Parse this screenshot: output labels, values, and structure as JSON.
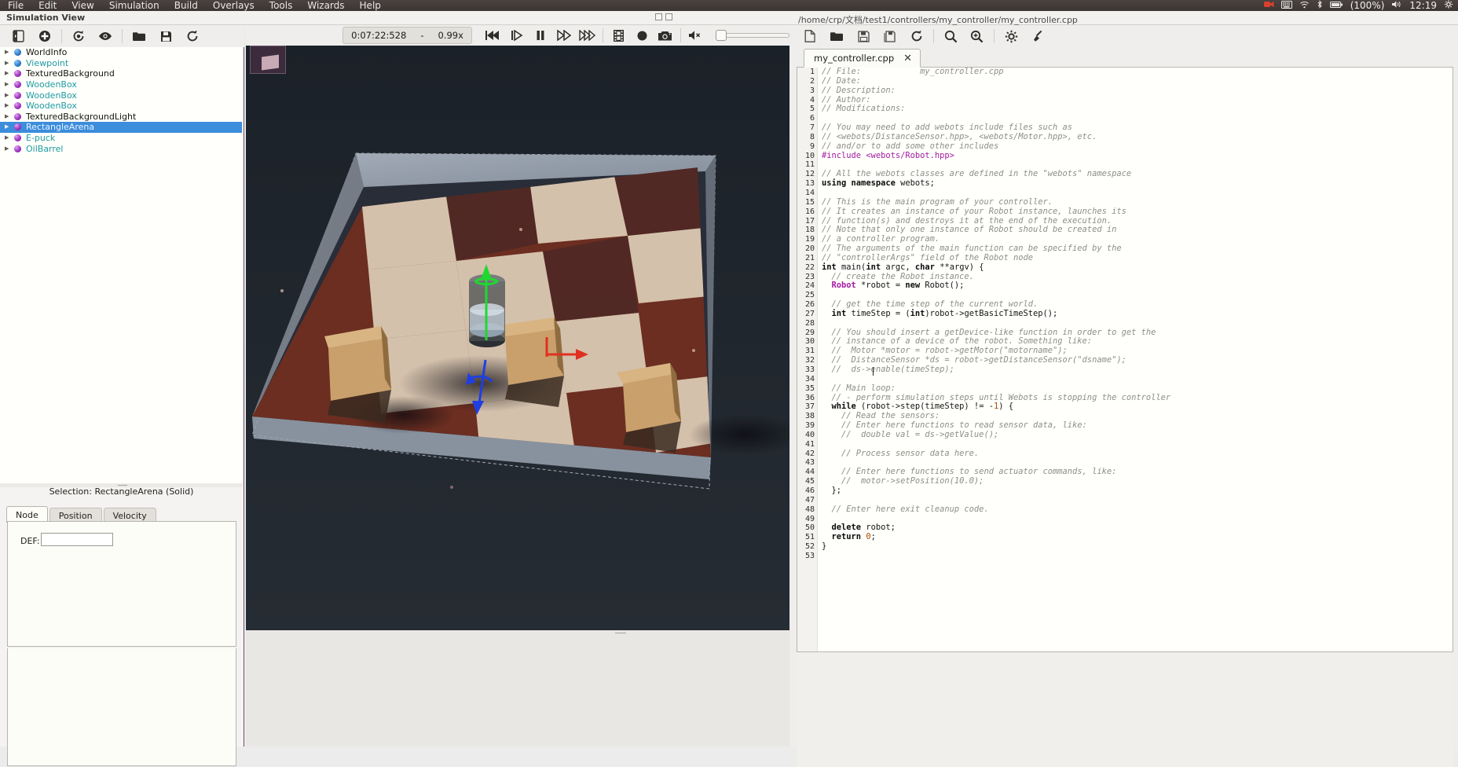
{
  "desktop": {
    "menus": [
      "File",
      "Edit",
      "View",
      "Simulation",
      "Build",
      "Overlays",
      "Tools",
      "Wizards",
      "Help"
    ],
    "tray": {
      "record_icon": "record-indicator-icon",
      "keyboard_icon": "keyboard-layout-icon",
      "wifi_icon": "wifi-icon",
      "bluetooth_icon": "bluetooth-icon",
      "battery_icon": "battery-icon",
      "battery_text": "(100%)",
      "volume_icon": "volume-icon",
      "clock": "12:19",
      "gear_icon": "system-settings-icon"
    }
  },
  "window": {
    "title": "Simulation View",
    "document_path": "/home/crp/文档/test1/controllers/my_controller/my_controller.cpp"
  },
  "scene_toolbar": {
    "buttons": [
      {
        "name": "toggle-sidebar-button",
        "icon": "panel-toggle-icon"
      },
      {
        "name": "add-node-button",
        "icon": "plus-circle-icon"
      },
      {
        "name": "transform-node-button",
        "icon": "refresh-node-icon"
      },
      {
        "name": "view-node-button",
        "icon": "eye-icon"
      },
      {
        "name": "open-world-button",
        "icon": "folder-open-icon"
      },
      {
        "name": "save-world-button",
        "icon": "floppy-save-icon"
      },
      {
        "name": "reload-world-button",
        "icon": "reload-icon"
      }
    ],
    "time": "0:07:22:528",
    "separator": "-",
    "speed": "0.99x",
    "transport": [
      {
        "name": "reset-button",
        "icon": "rewind-icon"
      },
      {
        "name": "step-button",
        "icon": "step-forward-icon"
      },
      {
        "name": "pause-button",
        "icon": "pause-icon"
      },
      {
        "name": "run-real-time-button",
        "icon": "fast-forward-icon"
      },
      {
        "name": "run-fast-button",
        "icon": "run-fast-icon"
      },
      {
        "name": "make-movie-button",
        "icon": "film-icon"
      },
      {
        "name": "record-button",
        "icon": "record-circle-icon"
      },
      {
        "name": "screenshot-button",
        "icon": "camera-icon"
      },
      {
        "name": "sound-mute-button",
        "icon": "speaker-muted-icon"
      }
    ],
    "volume_value": 0
  },
  "scene_tree": {
    "nodes": [
      {
        "label": "WorldInfo",
        "ball": "blue",
        "style": "black",
        "selected": false
      },
      {
        "label": "Viewpoint",
        "ball": "blue",
        "style": "teal",
        "selected": false
      },
      {
        "label": "TexturedBackground",
        "ball": "purple",
        "style": "black",
        "selected": false
      },
      {
        "label": "WoodenBox",
        "ball": "purple",
        "style": "teal",
        "selected": false
      },
      {
        "label": "WoodenBox",
        "ball": "purple",
        "style": "teal",
        "selected": false
      },
      {
        "label": "WoodenBox",
        "ball": "purple",
        "style": "teal",
        "selected": false
      },
      {
        "label": "TexturedBackgroundLight",
        "ball": "purple",
        "style": "black",
        "selected": false
      },
      {
        "label": "RectangleArena",
        "ball": "purple",
        "style": "teal",
        "selected": true
      },
      {
        "label": "E-puck",
        "ball": "purple",
        "style": "teal",
        "selected": false
      },
      {
        "label": "OilBarrel",
        "ball": "purple",
        "style": "teal",
        "selected": false
      }
    ]
  },
  "node_panel": {
    "selection_text": "Selection: RectangleArena (Solid)",
    "tabs": [
      "Node",
      "Position",
      "Velocity"
    ],
    "active_tab": "Node",
    "def_label": "DEF:",
    "def_value": ""
  },
  "editor": {
    "toolbar": [
      {
        "name": "new-file-button",
        "icon": "new-file-icon"
      },
      {
        "name": "open-file-button",
        "icon": "folder-open-icon"
      },
      {
        "name": "save-file-button",
        "icon": "save-icon"
      },
      {
        "name": "save-all-button",
        "icon": "save-all-icon"
      },
      {
        "name": "revert-file-button",
        "icon": "reload-icon"
      },
      {
        "name": "find-button",
        "icon": "search-icon"
      },
      {
        "name": "find-replace-button",
        "icon": "search-replace-icon"
      },
      {
        "name": "build-settings-button",
        "icon": "gear-icon"
      },
      {
        "name": "clean-button",
        "icon": "broom-icon"
      }
    ],
    "tab_label": "my_controller.cpp",
    "tab_close": "✕",
    "line_count": 53,
    "lines": [
      {
        "n": 1,
        "tokens": [
          {
            "t": "// File:            my_controller.cpp",
            "c": "cmt"
          }
        ]
      },
      {
        "n": 2,
        "tokens": [
          {
            "t": "// Date:",
            "c": "cmt"
          }
        ]
      },
      {
        "n": 3,
        "tokens": [
          {
            "t": "// Description:",
            "c": "cmt"
          }
        ]
      },
      {
        "n": 4,
        "tokens": [
          {
            "t": "// Author:",
            "c": "cmt"
          }
        ]
      },
      {
        "n": 5,
        "tokens": [
          {
            "t": "// Modifications:",
            "c": "cmt"
          }
        ]
      },
      {
        "n": 6,
        "tokens": []
      },
      {
        "n": 7,
        "tokens": [
          {
            "t": "// You may need to add webots include files such as",
            "c": "cmt"
          }
        ]
      },
      {
        "n": 8,
        "tokens": [
          {
            "t": "// <webots/DistanceSensor.hpp>, <webots/Motor.hpp>, etc.",
            "c": "cmt"
          }
        ]
      },
      {
        "n": 9,
        "tokens": [
          {
            "t": "// and/or to add some other includes",
            "c": "cmt"
          }
        ]
      },
      {
        "n": 10,
        "tokens": [
          {
            "t": "#include <webots/Robot.hpp>",
            "c": "pre"
          }
        ]
      },
      {
        "n": 11,
        "tokens": []
      },
      {
        "n": 12,
        "tokens": [
          {
            "t": "// All the webots classes are defined in the \"webots\" namespace",
            "c": "cmt"
          }
        ]
      },
      {
        "n": 13,
        "tokens": [
          {
            "t": "using",
            "c": "kw"
          },
          {
            "t": " ",
            "c": "pln"
          },
          {
            "t": "namespace",
            "c": "kw"
          },
          {
            "t": " webots;",
            "c": "pln"
          }
        ]
      },
      {
        "n": 14,
        "tokens": []
      },
      {
        "n": 15,
        "tokens": [
          {
            "t": "// This is the main program of your controller.",
            "c": "cmt"
          }
        ]
      },
      {
        "n": 16,
        "tokens": [
          {
            "t": "// It creates an instance of your Robot instance, launches its",
            "c": "cmt"
          }
        ]
      },
      {
        "n": 17,
        "tokens": [
          {
            "t": "// function(s) and destroys it at the end of the execution.",
            "c": "cmt"
          }
        ]
      },
      {
        "n": 18,
        "tokens": [
          {
            "t": "// Note that only one instance of Robot should be created in",
            "c": "cmt"
          }
        ]
      },
      {
        "n": 19,
        "tokens": [
          {
            "t": "// a controller program.",
            "c": "cmt"
          }
        ]
      },
      {
        "n": 20,
        "tokens": [
          {
            "t": "// The arguments of the main function can be specified by the",
            "c": "cmt"
          }
        ]
      },
      {
        "n": 21,
        "tokens": [
          {
            "t": "// \"controllerArgs\" field of the Robot node",
            "c": "cmt"
          }
        ]
      },
      {
        "n": 22,
        "tokens": [
          {
            "t": "int",
            "c": "kw"
          },
          {
            "t": " main(",
            "c": "pln"
          },
          {
            "t": "int",
            "c": "kw"
          },
          {
            "t": " argc, ",
            "c": "pln"
          },
          {
            "t": "char",
            "c": "kw"
          },
          {
            "t": " **argv) {",
            "c": "pln"
          }
        ]
      },
      {
        "n": 23,
        "tokens": [
          {
            "t": "  // create the Robot instance.",
            "c": "cmt"
          }
        ]
      },
      {
        "n": 24,
        "tokens": [
          {
            "t": "  ",
            "c": "pln"
          },
          {
            "t": "Robot",
            "c": "typ"
          },
          {
            "t": " *robot = ",
            "c": "pln"
          },
          {
            "t": "new",
            "c": "kw"
          },
          {
            "t": " Robot();",
            "c": "pln"
          }
        ]
      },
      {
        "n": 25,
        "tokens": []
      },
      {
        "n": 26,
        "tokens": [
          {
            "t": "  // get the time step of the current world.",
            "c": "cmt"
          }
        ]
      },
      {
        "n": 27,
        "tokens": [
          {
            "t": "  ",
            "c": "pln"
          },
          {
            "t": "int",
            "c": "kw"
          },
          {
            "t": " timeStep = (",
            "c": "pln"
          },
          {
            "t": "int",
            "c": "kw"
          },
          {
            "t": ")robot->getBasicTimeStep();",
            "c": "pln"
          }
        ]
      },
      {
        "n": 28,
        "tokens": []
      },
      {
        "n": 29,
        "tokens": [
          {
            "t": "  // You should insert a getDevice-like function in order to get the",
            "c": "cmt"
          }
        ]
      },
      {
        "n": 30,
        "tokens": [
          {
            "t": "  // instance of a device of the robot. Something like:",
            "c": "cmt"
          }
        ]
      },
      {
        "n": 31,
        "tokens": [
          {
            "t": "  //  Motor *motor = robot->getMotor(\"motorname\");",
            "c": "cmt"
          }
        ]
      },
      {
        "n": 32,
        "tokens": [
          {
            "t": "  //  DistanceSensor *ds = robot->getDistanceSensor(\"dsname\");",
            "c": "cmt"
          }
        ]
      },
      {
        "n": 33,
        "tokens": [
          {
            "t": "  //  ds->enable(timeStep);",
            "c": "cmt"
          }
        ]
      },
      {
        "n": 34,
        "tokens": []
      },
      {
        "n": 35,
        "tokens": [
          {
            "t": "  // Main loop:",
            "c": "cmt"
          }
        ]
      },
      {
        "n": 36,
        "tokens": [
          {
            "t": "  // - perform simulation steps until Webots is stopping the controller",
            "c": "cmt"
          }
        ]
      },
      {
        "n": 37,
        "tokens": [
          {
            "t": "  ",
            "c": "pln"
          },
          {
            "t": "while",
            "c": "kw"
          },
          {
            "t": " (robot->step(timeStep) != -",
            "c": "pln"
          },
          {
            "t": "1",
            "c": "num"
          },
          {
            "t": ") {",
            "c": "pln"
          }
        ]
      },
      {
        "n": 38,
        "tokens": [
          {
            "t": "    // Read the sensors:",
            "c": "cmt"
          }
        ]
      },
      {
        "n": 39,
        "tokens": [
          {
            "t": "    // Enter here functions to read sensor data, like:",
            "c": "cmt"
          }
        ]
      },
      {
        "n": 40,
        "tokens": [
          {
            "t": "    //  double val = ds->getValue();",
            "c": "cmt"
          }
        ]
      },
      {
        "n": 41,
        "tokens": []
      },
      {
        "n": 42,
        "tokens": [
          {
            "t": "    // Process sensor data here.",
            "c": "cmt"
          }
        ]
      },
      {
        "n": 43,
        "tokens": []
      },
      {
        "n": 44,
        "tokens": [
          {
            "t": "    // Enter here functions to send actuator commands, like:",
            "c": "cmt"
          }
        ]
      },
      {
        "n": 45,
        "tokens": [
          {
            "t": "    //  motor->setPosition(10.0);",
            "c": "cmt"
          }
        ]
      },
      {
        "n": 46,
        "tokens": [
          {
            "t": "  };",
            "c": "pln"
          }
        ]
      },
      {
        "n": 47,
        "tokens": []
      },
      {
        "n": 48,
        "tokens": [
          {
            "t": "  // Enter here exit cleanup code.",
            "c": "cmt"
          }
        ]
      },
      {
        "n": 49,
        "tokens": []
      },
      {
        "n": 50,
        "tokens": [
          {
            "t": "  ",
            "c": "pln"
          },
          {
            "t": "delete",
            "c": "kw"
          },
          {
            "t": " robot;",
            "c": "pln"
          }
        ]
      },
      {
        "n": 51,
        "tokens": [
          {
            "t": "  ",
            "c": "pln"
          },
          {
            "t": "return",
            "c": "kw"
          },
          {
            "t": " ",
            "c": "pln"
          },
          {
            "t": "0",
            "c": "num"
          },
          {
            "t": ";",
            "c": "pln"
          }
        ]
      },
      {
        "n": 52,
        "tokens": [
          {
            "t": "}",
            "c": "pln"
          }
        ]
      },
      {
        "n": 53,
        "tokens": []
      }
    ]
  },
  "viewport": {
    "thumbnail_name": "viewport-thumbnail",
    "robot_name": "e-puck-robot",
    "gizmo": {
      "x_axis": "#e03020",
      "y_axis": "#1fd92f",
      "z_axis": "#1f3fe0"
    },
    "boxes": [
      "wooden-box-1",
      "wooden-box-2",
      "wooden-box-3"
    ],
    "floor_colors": [
      "#f2dcc4",
      "#7b3526"
    ]
  },
  "colors": {
    "selection_blue": "#3c8ddc",
    "teal_text": "#1f9ba3",
    "panel_bg": "#efeeec",
    "editor_bg": "#fffffc",
    "comment": "#8e8d86",
    "preprocessor": "#a21aa2"
  }
}
